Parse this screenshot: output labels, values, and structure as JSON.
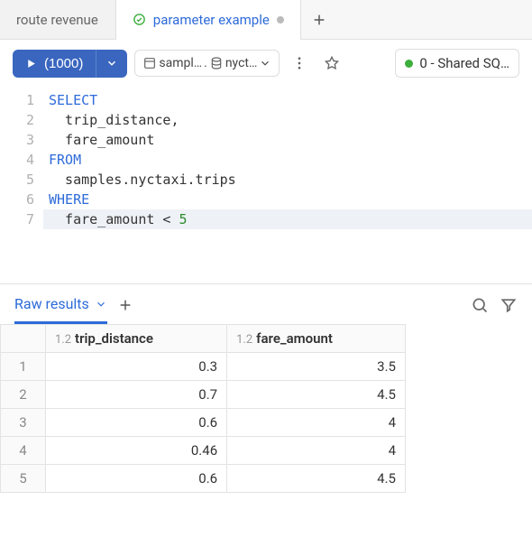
{
  "tabs": {
    "inactive_label": "route revenue",
    "active_label": "parameter example"
  },
  "toolbar": {
    "run_label": "(1000)",
    "schema_part1": "sampl…",
    "schema_part2": "nyct…",
    "cluster_label": "0 - Shared SQ…"
  },
  "editor": {
    "lines": [
      {
        "n": "1",
        "html": "<span class='kw'>SELECT</span>"
      },
      {
        "n": "2",
        "html": "  trip_distance,"
      },
      {
        "n": "3",
        "html": "  fare_amount"
      },
      {
        "n": "4",
        "html": "<span class='kw'>FROM</span>"
      },
      {
        "n": "5",
        "html": "  samples.nyctaxi.trips"
      },
      {
        "n": "6",
        "html": "<span class='kw'>WHERE</span>"
      },
      {
        "n": "7",
        "html": "  fare_amount &lt; <span class='num'>5</span>",
        "hl": true
      }
    ]
  },
  "results": {
    "tab_label": "Raw results",
    "type_label": "1.2",
    "columns": [
      "trip_distance",
      "fare_amount"
    ],
    "rows": [
      {
        "n": "1",
        "cells": [
          "0.3",
          "3.5"
        ]
      },
      {
        "n": "2",
        "cells": [
          "0.7",
          "4.5"
        ]
      },
      {
        "n": "3",
        "cells": [
          "0.6",
          "4"
        ]
      },
      {
        "n": "4",
        "cells": [
          "0.46",
          "4"
        ]
      },
      {
        "n": "5",
        "cells": [
          "0.6",
          "4.5"
        ]
      }
    ]
  },
  "chart_data": {
    "type": "table",
    "columns": [
      "trip_distance",
      "fare_amount"
    ],
    "rows": [
      [
        0.3,
        3.5
      ],
      [
        0.7,
        4.5
      ],
      [
        0.6,
        4
      ],
      [
        0.46,
        4
      ],
      [
        0.6,
        4.5
      ]
    ]
  }
}
